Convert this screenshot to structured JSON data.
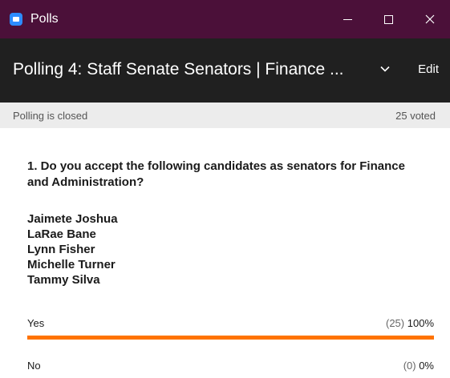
{
  "window": {
    "title": "Polls",
    "icon": "zoom-app-icon"
  },
  "poll": {
    "title": "Polling 4: Staff Senate Senators | Finance ...",
    "edit_label": "Edit",
    "status": "Polling is closed",
    "voted": "25 voted"
  },
  "question": {
    "text": "1. Do you accept the following candidates as senators for Finance and Administration?",
    "candidates": [
      "Jaimete Joshua",
      "LaRae Bane",
      "Lynn Fisher",
      "Michelle Turner",
      "Tammy Silva"
    ]
  },
  "answers": [
    {
      "label": "Yes",
      "count": "(25)",
      "percent": "100%",
      "fraction": 1.0
    },
    {
      "label": "No",
      "count": "(0)",
      "percent": "0%",
      "fraction": 0.0
    }
  ],
  "colors": {
    "titlebar": "#4b1039",
    "header": "#202020",
    "bar": "#ff7300"
  }
}
